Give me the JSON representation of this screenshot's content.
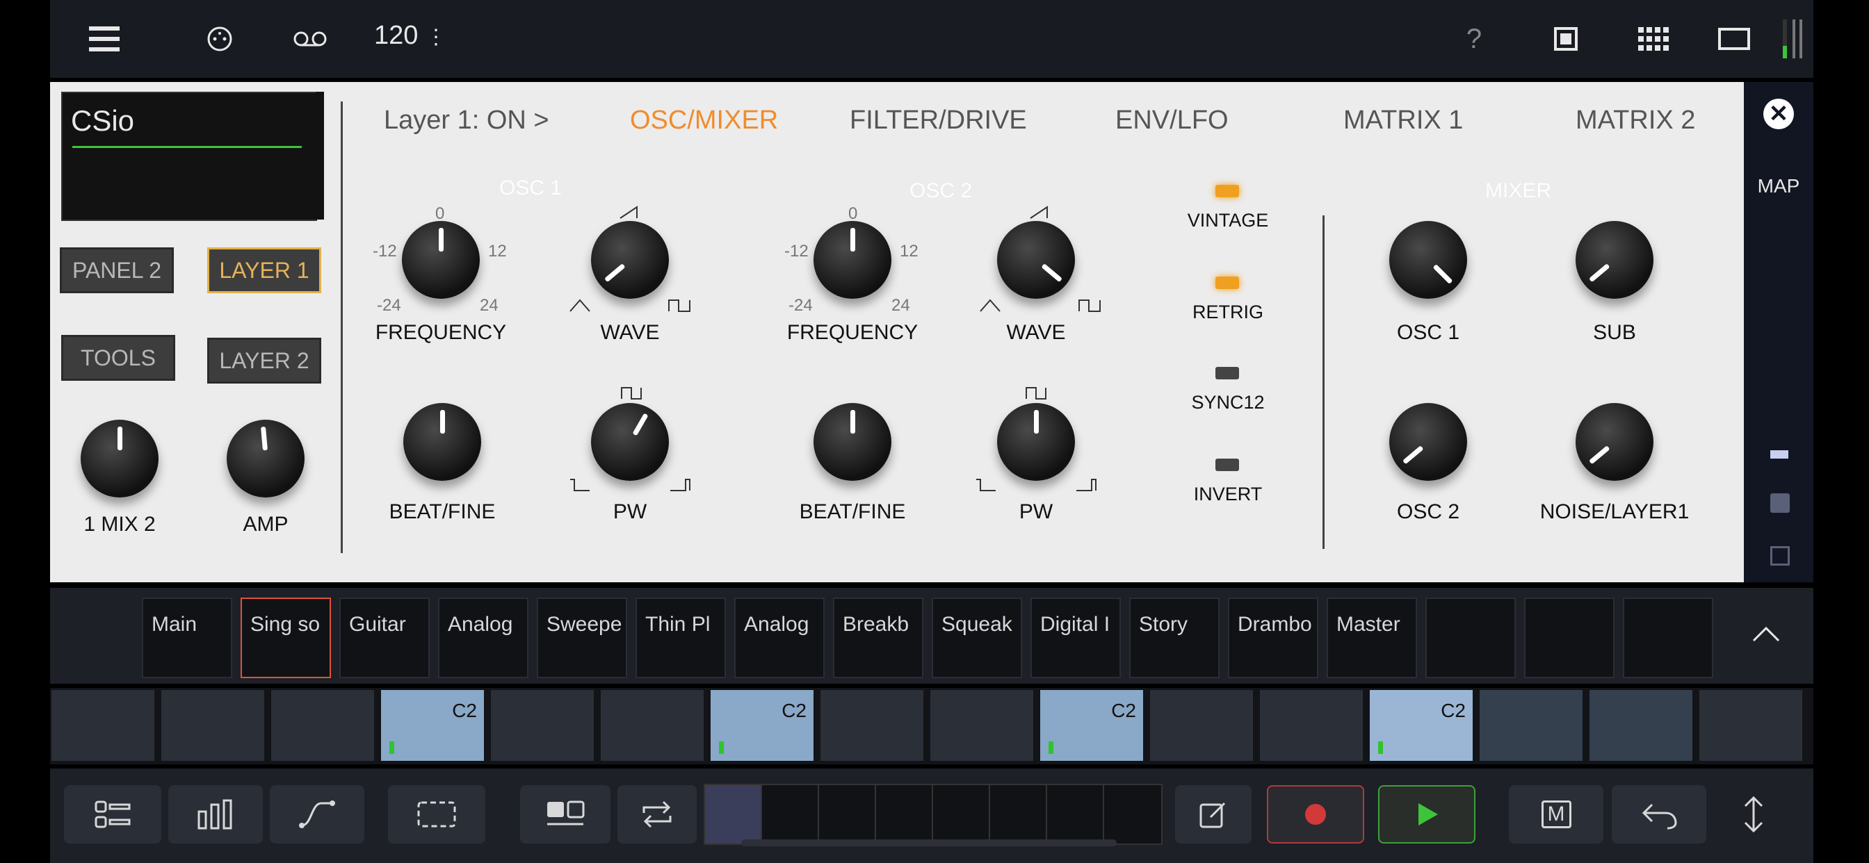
{
  "topbar": {
    "bpm": "120"
  },
  "preset": {
    "name": "CSio"
  },
  "left_buttons": {
    "panel2": "PANEL 2",
    "layer1": "LAYER 1",
    "tools": "TOOLS",
    "layer2": "LAYER 2",
    "mix_label": "1 MIX 2",
    "amp_label": "AMP"
  },
  "tabs": [
    "Layer 1: ON >",
    "OSC/MIXER",
    "FILTER/DRIVE",
    "ENV/LFO",
    "MATRIX 1",
    "MATRIX 2"
  ],
  "active_tab": 1,
  "sections": {
    "osc1": "OSC 1",
    "osc2": "OSC 2",
    "mixer": "MIXER"
  },
  "knob_labels": {
    "osc1_frequency": "FREQUENCY",
    "osc1_wave": "WAVE",
    "osc1_beat": "BEAT/FINE",
    "osc1_pw": "PW",
    "osc2_frequency": "FREQUENCY",
    "osc2_wave": "WAVE",
    "osc2_beat": "BEAT/FINE",
    "osc2_pw": "PW",
    "mix_osc1": "OSC 1",
    "mix_sub": "SUB",
    "mix_osc2": "OSC 2",
    "mix_noise": "NOISE/LAYER1"
  },
  "freq_ticks": {
    "top": "0",
    "left": "-12",
    "right": "12",
    "bottom_left": "-24",
    "bottom_right": "24"
  },
  "switches": [
    {
      "label": "VINTAGE",
      "on": true
    },
    {
      "label": "RETRIG",
      "on": true
    },
    {
      "label": "SYNC12",
      "on": false
    },
    {
      "label": "INVERT",
      "on": false
    }
  ],
  "rightstrip": {
    "map": "MAP"
  },
  "patterns": [
    "Main",
    "Sing so",
    "Guitar",
    "Analog",
    "Sweepe",
    "Thin Pl",
    "Analog",
    "Breakb",
    "Squeak",
    "Digital I",
    "Story",
    "Drambo",
    "Master",
    "",
    "",
    ""
  ],
  "selected_pattern": 1,
  "steps": [
    {
      "on": false,
      "note": ""
    },
    {
      "on": false,
      "note": ""
    },
    {
      "on": false,
      "note": ""
    },
    {
      "on": true,
      "note": "C2"
    },
    {
      "on": false,
      "note": ""
    },
    {
      "on": false,
      "note": ""
    },
    {
      "on": true,
      "note": "C2"
    },
    {
      "on": false,
      "note": ""
    },
    {
      "on": false,
      "note": ""
    },
    {
      "on": true,
      "note": "C2"
    },
    {
      "on": false,
      "note": ""
    },
    {
      "on": false,
      "note": ""
    },
    {
      "on": true,
      "note": "C2"
    },
    {
      "on": false,
      "note": ""
    },
    {
      "on": false,
      "note": ""
    },
    {
      "on": false,
      "note": ""
    }
  ],
  "bottom": {
    "m_label": "M"
  }
}
